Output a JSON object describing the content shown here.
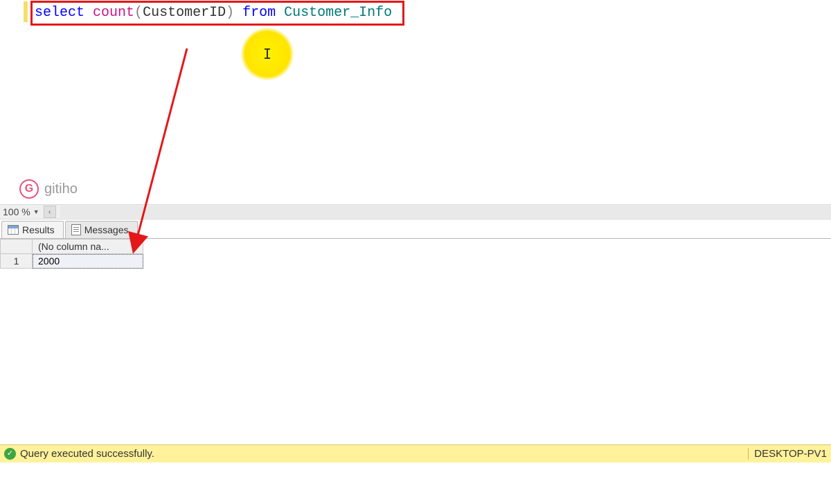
{
  "editor": {
    "sql_tokens": {
      "select": "select",
      "count": "count",
      "paren_open": "(",
      "argument": "CustomerID",
      "paren_close": ")",
      "from": "from",
      "table": "Customer_Info"
    }
  },
  "watermark": {
    "logo_letter": "G",
    "text": "gitiho"
  },
  "zoom": {
    "level": "100 %"
  },
  "tabs": {
    "results": "Results",
    "messages": "Messages"
  },
  "grid": {
    "columns": [
      "(No column na..."
    ],
    "rows": [
      {
        "rownum": "1",
        "values": [
          "2000"
        ]
      }
    ]
  },
  "status": {
    "message": "Query executed successfully.",
    "server": "DESKTOP-PV1"
  }
}
